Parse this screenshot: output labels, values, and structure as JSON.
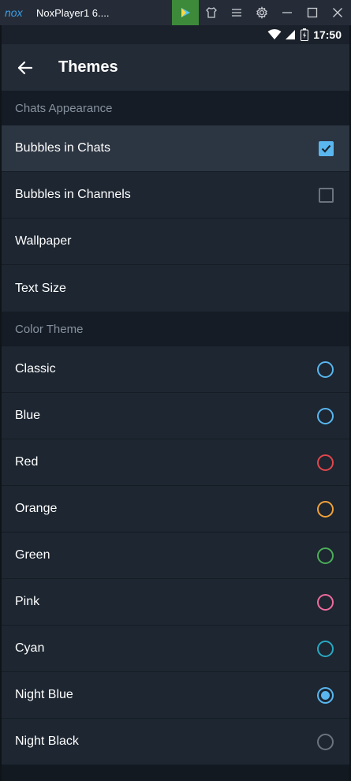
{
  "emulator": {
    "title": "NoxPlayer1 6....",
    "logo_icon": "nox-logo-icon",
    "play_store_icon": "play-store-icon",
    "buttons": [
      "shirt-icon",
      "menu-icon",
      "gear-icon",
      "minimize-icon",
      "maximize-icon",
      "close-icon"
    ]
  },
  "status_bar": {
    "time": "17:50",
    "icons": [
      "wifi-icon",
      "signal-icon",
      "battery-icon"
    ]
  },
  "toolbar": {
    "title": "Themes",
    "back_icon": "back-arrow-icon"
  },
  "sections": {
    "chats_appearance": {
      "header": "Chats Appearance",
      "items": [
        {
          "label": "Bubbles in Chats",
          "checked": true
        },
        {
          "label": "Bubbles in Channels",
          "checked": false
        },
        {
          "label": "Wallpaper"
        },
        {
          "label": "Text Size"
        }
      ]
    },
    "color_theme": {
      "header": "Color Theme",
      "items": [
        {
          "label": "Classic",
          "color": "#59b6ef",
          "selected": false
        },
        {
          "label": "Blue",
          "color": "#59b6ef",
          "selected": false
        },
        {
          "label": "Red",
          "color": "#e0474c",
          "selected": false
        },
        {
          "label": "Orange",
          "color": "#f0a23a",
          "selected": false
        },
        {
          "label": "Green",
          "color": "#4cae58",
          "selected": false
        },
        {
          "label": "Pink",
          "color": "#ee6b9c",
          "selected": false
        },
        {
          "label": "Cyan",
          "color": "#28a9c2",
          "selected": false
        },
        {
          "label": "Night Blue",
          "color": "#59b6ef",
          "selected": true
        },
        {
          "label": "Night Black",
          "color": "#6a737e",
          "selected": false
        }
      ]
    }
  },
  "colors": {
    "accent": "#59b6ef",
    "background": "#121920",
    "row_background": "#1d2631",
    "toolbar": "#222b36"
  }
}
